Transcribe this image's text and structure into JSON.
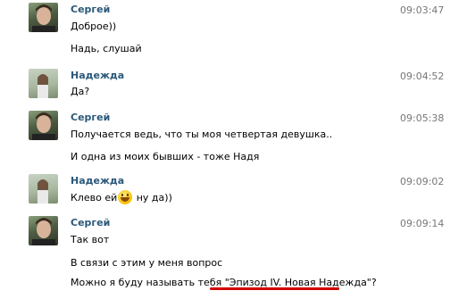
{
  "messages": [
    {
      "author": "Сергей",
      "time": "09:03:47",
      "lines": [
        "Доброе))",
        "Надь, слушай"
      ]
    },
    {
      "author": "Надежда",
      "time": "09:04:52",
      "lines": [
        "Да?"
      ]
    },
    {
      "author": "Сергей",
      "time": "09:05:38",
      "lines": [
        "Получается ведь, что ты моя четвертая девушка..",
        "И одна из моих бывших - тоже Надя"
      ]
    },
    {
      "author": "Надежда",
      "time": "09:09:02",
      "text_before": "Клево ей",
      "emoji": "smile-emoji",
      "text_after": " ну да))"
    },
    {
      "author": "Сергей",
      "time": "09:09:14",
      "lines": [
        "Так вот",
        "В связи с этим у меня вопрос"
      ],
      "last_prefix": "Можно я буду называть тебя ",
      "last_quote": "\"Эпизод IV. Новая Надежда\"",
      "last_suffix": "?"
    }
  ],
  "colors": {
    "name": "#2b587a",
    "time": "#777777",
    "underline": "#d40000"
  }
}
